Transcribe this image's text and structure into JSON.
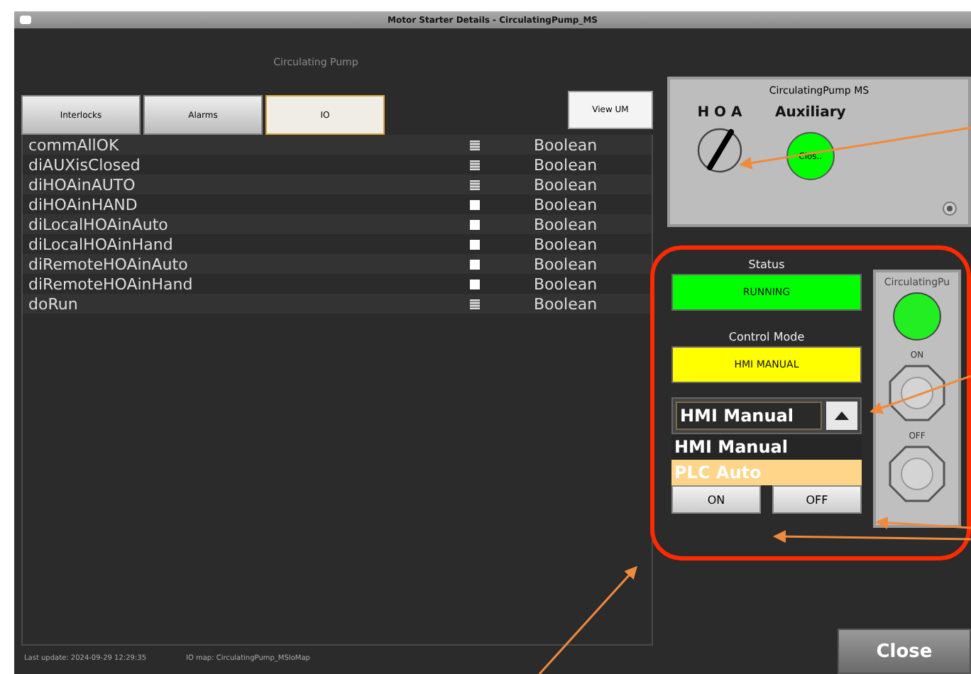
{
  "window": {
    "title": "Motor Starter Details - CirculatingPump_MS"
  },
  "heading": "Circulating Pump",
  "tabs": [
    {
      "label": "Interlocks",
      "selected": false
    },
    {
      "label": "Alarms",
      "selected": false
    },
    {
      "label": "IO",
      "selected": true
    }
  ],
  "view_um_button": "View UM",
  "io_rows": [
    {
      "name": "commAllOK",
      "on": true,
      "type": "Boolean"
    },
    {
      "name": "diAUXisClosed",
      "on": true,
      "type": "Boolean"
    },
    {
      "name": "diHOAinAUTO",
      "on": true,
      "type": "Boolean"
    },
    {
      "name": "diHOAinHAND",
      "on": false,
      "type": "Boolean"
    },
    {
      "name": "diLocalHOAinAuto",
      "on": false,
      "type": "Boolean"
    },
    {
      "name": "diLocalHOAinHand",
      "on": false,
      "type": "Boolean"
    },
    {
      "name": "diRemoteHOAinAuto",
      "on": false,
      "type": "Boolean"
    },
    {
      "name": "diRemoteHOAinHand",
      "on": false,
      "type": "Boolean"
    },
    {
      "name": "doRun",
      "on": true,
      "type": "Boolean"
    }
  ],
  "faceplate": {
    "title": "CirculatingPump MS",
    "hoa_label": "H O A",
    "auxiliary_label": "Auxiliary",
    "auxiliary_state": "Clos..",
    "auxiliary_on": true
  },
  "status": {
    "label": "Status",
    "value": "RUNNING"
  },
  "control_mode": {
    "label": "Control Mode",
    "value": "HMI MANUAL"
  },
  "mode_dropdown": {
    "value": "HMI Manual",
    "expanded": true,
    "options": [
      {
        "label": "HMI Manual",
        "highlighted": false
      },
      {
        "label": "PLC Auto",
        "highlighted": true
      }
    ]
  },
  "command_buttons": [
    "ON",
    "OFF"
  ],
  "local_panel": {
    "title": "CirculatingPu",
    "running": true,
    "buttons": [
      "ON",
      "OFF"
    ]
  },
  "footer": {
    "last_update": "Last update: 2024-09-29 12:29:35",
    "io_map": "IO map: CirculatingPump_MSIoMap"
  },
  "close_button": "Close"
}
